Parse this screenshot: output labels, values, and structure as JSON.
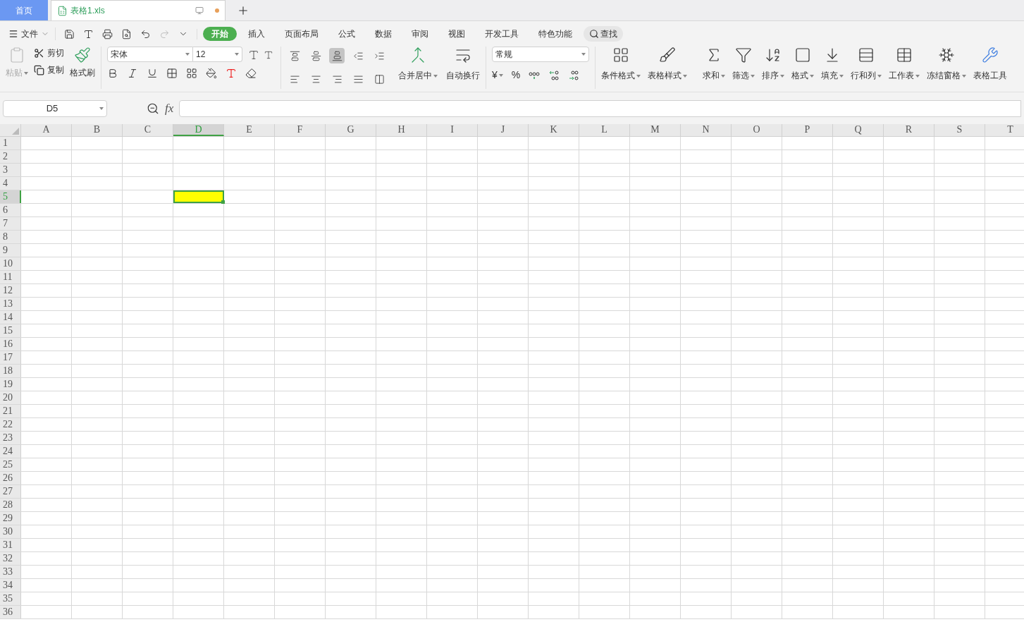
{
  "tabs": [
    {
      "label": "首页",
      "kind": "home",
      "selected": false
    },
    {
      "label": "表格1.xls",
      "kind": "file",
      "selected": true,
      "unsaved": true
    }
  ],
  "menu": {
    "file": "文件",
    "tabs": [
      {
        "label": "开始",
        "selected": true
      },
      {
        "label": "插入",
        "selected": false
      },
      {
        "label": "页面布局",
        "selected": false
      },
      {
        "label": "公式",
        "selected": false
      },
      {
        "label": "数据",
        "selected": false
      },
      {
        "label": "审阅",
        "selected": false
      },
      {
        "label": "视图",
        "selected": false
      },
      {
        "label": "开发工具",
        "selected": false
      },
      {
        "label": "特色功能",
        "selected": false
      }
    ],
    "search": "查找"
  },
  "clipboard": {
    "paste": {
      "label": "粘贴",
      "disabled": true
    },
    "cut": "剪切",
    "copy": "复制",
    "painter": "格式刷"
  },
  "font": {
    "name": "宋体",
    "size": "12"
  },
  "align_buttons": [
    {
      "kind": "top",
      "selected": false
    },
    {
      "kind": "middle",
      "selected": false
    },
    {
      "kind": "bottom",
      "selected": true
    },
    {
      "kind": "outdent",
      "selected": false
    },
    {
      "kind": "indent",
      "selected": false
    },
    {
      "kind": "left",
      "selected": false
    },
    {
      "kind": "center",
      "selected": false
    },
    {
      "kind": "right",
      "selected": false
    },
    {
      "kind": "justify",
      "selected": false
    },
    {
      "kind": "distribute",
      "selected": false
    }
  ],
  "merge": "合并居中",
  "wrap": "自动换行",
  "number": {
    "format": "常规",
    "currency": "¥",
    "percent": "%"
  },
  "big_buttons": [
    {
      "label": "条件格式",
      "kind": "conditional"
    },
    {
      "label": "表格样式",
      "kind": "style"
    },
    {
      "label": "求和",
      "kind": "sum"
    },
    {
      "label": "筛选",
      "kind": "filter"
    },
    {
      "label": "排序",
      "kind": "sort"
    },
    {
      "label": "格式",
      "kind": "format"
    },
    {
      "label": "填充",
      "kind": "fill"
    },
    {
      "label": "行和列",
      "kind": "rowcol"
    },
    {
      "label": "工作表",
      "kind": "sheet"
    },
    {
      "label": "冻结窗格",
      "kind": "freeze"
    },
    {
      "label": "表格工具",
      "kind": "tools"
    }
  ],
  "formula_bar": {
    "name_box": "D5",
    "fx": "fx"
  },
  "sheet": {
    "columns": [
      {
        "label": "A",
        "selected": false
      },
      {
        "label": "B",
        "selected": false
      },
      {
        "label": "C",
        "selected": false
      },
      {
        "label": "D",
        "selected": true
      },
      {
        "label": "E",
        "selected": false
      },
      {
        "label": "F",
        "selected": false
      },
      {
        "label": "G",
        "selected": false
      },
      {
        "label": "H",
        "selected": false
      },
      {
        "label": "I",
        "selected": false
      },
      {
        "label": "J",
        "selected": false
      },
      {
        "label": "K",
        "selected": false
      },
      {
        "label": "L",
        "selected": false
      },
      {
        "label": "M",
        "selected": false
      },
      {
        "label": "N",
        "selected": false
      },
      {
        "label": "O",
        "selected": false
      },
      {
        "label": "P",
        "selected": false
      },
      {
        "label": "Q",
        "selected": false
      },
      {
        "label": "R",
        "selected": false
      },
      {
        "label": "S",
        "selected": false
      },
      {
        "label": "T",
        "selected": false
      }
    ],
    "rows": [
      {
        "label": "1",
        "selected": false
      },
      {
        "label": "2",
        "selected": false
      },
      {
        "label": "3",
        "selected": false
      },
      {
        "label": "4",
        "selected": false
      },
      {
        "label": "5",
        "selected": true
      },
      {
        "label": "6",
        "selected": false
      },
      {
        "label": "7",
        "selected": false
      },
      {
        "label": "8",
        "selected": false
      },
      {
        "label": "9",
        "selected": false
      },
      {
        "label": "10",
        "selected": false
      },
      {
        "label": "11",
        "selected": false
      },
      {
        "label": "12",
        "selected": false
      },
      {
        "label": "13",
        "selected": false
      },
      {
        "label": "14",
        "selected": false
      },
      {
        "label": "15",
        "selected": false
      },
      {
        "label": "16",
        "selected": false
      },
      {
        "label": "17",
        "selected": false
      },
      {
        "label": "18",
        "selected": false
      },
      {
        "label": "19",
        "selected": false
      },
      {
        "label": "20",
        "selected": false
      },
      {
        "label": "21",
        "selected": false
      },
      {
        "label": "22",
        "selected": false
      },
      {
        "label": "23",
        "selected": false
      },
      {
        "label": "24",
        "selected": false
      },
      {
        "label": "25",
        "selected": false
      },
      {
        "label": "26",
        "selected": false
      },
      {
        "label": "27",
        "selected": false
      },
      {
        "label": "28",
        "selected": false
      },
      {
        "label": "29",
        "selected": false
      },
      {
        "label": "30",
        "selected": false
      },
      {
        "label": "31",
        "selected": false
      },
      {
        "label": "32",
        "selected": false
      },
      {
        "label": "33",
        "selected": false
      },
      {
        "label": "34",
        "selected": false
      },
      {
        "label": "35",
        "selected": false
      },
      {
        "label": "36",
        "selected": false
      }
    ],
    "selected_cell": {
      "color": "#ffff00"
    }
  }
}
